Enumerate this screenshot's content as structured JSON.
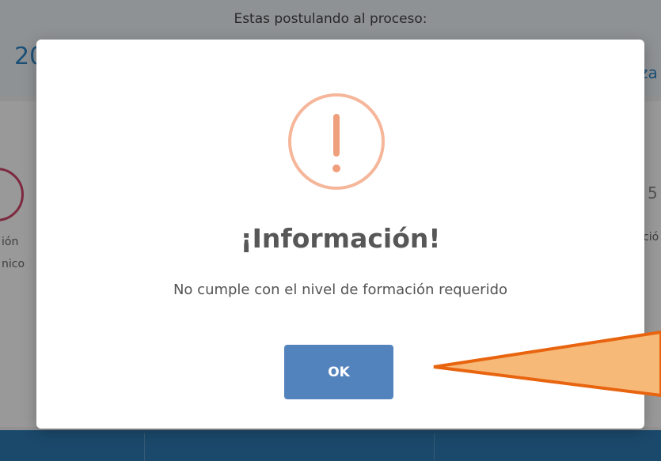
{
  "background": {
    "subtitle": "Estas postulando al proceso:",
    "left_fragment": "20",
    "right_fragment": "za",
    "left_step_text": "ión\nnico",
    "right_step_number": "5",
    "right_step_text": "ció"
  },
  "modal": {
    "title": "¡Información!",
    "message": "No cumple con el nivel de formación requerido",
    "ok_label": "OK",
    "icon": "exclamation-icon",
    "icon_color": "#f5b69a",
    "button_color": "#5383bd"
  },
  "annotation": {
    "fill_color": "#f6b978",
    "stroke_color": "#e8640f"
  }
}
